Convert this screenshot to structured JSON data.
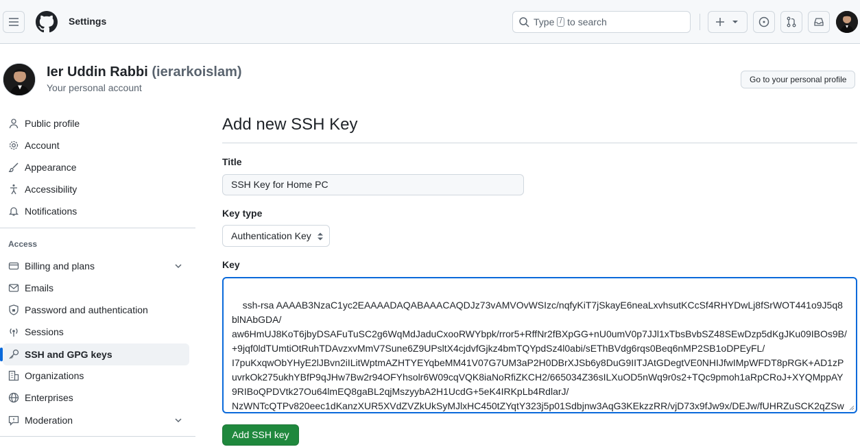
{
  "header": {
    "context_title": "Settings",
    "search_prefix": "Type",
    "search_kbd": "/",
    "search_suffix": "to search"
  },
  "profile": {
    "name": "Ier Uddin Rabbi",
    "login": "(ierarkoislam)",
    "subtitle": "Your personal account",
    "go_to_profile": "Go to your personal profile"
  },
  "sidebar": {
    "items": [
      {
        "label": "Public profile",
        "icon": "person-icon"
      },
      {
        "label": "Account",
        "icon": "gear-icon"
      },
      {
        "label": "Appearance",
        "icon": "paintbrush-icon"
      },
      {
        "label": "Accessibility",
        "icon": "accessibility-icon"
      },
      {
        "label": "Notifications",
        "icon": "bell-icon"
      }
    ],
    "access_heading": "Access",
    "access_items": [
      {
        "label": "Billing and plans",
        "icon": "credit-card-icon",
        "expandable": true
      },
      {
        "label": "Emails",
        "icon": "mail-icon"
      },
      {
        "label": "Password and authentication",
        "icon": "shield-lock-icon"
      },
      {
        "label": "Sessions",
        "icon": "broadcast-icon"
      },
      {
        "label": "SSH and GPG keys",
        "icon": "key-icon",
        "active": true
      },
      {
        "label": "Organizations",
        "icon": "organization-icon"
      },
      {
        "label": "Enterprises",
        "icon": "globe-icon"
      },
      {
        "label": "Moderation",
        "icon": "report-icon",
        "expandable": true
      }
    ]
  },
  "form": {
    "heading": "Add new SSH Key",
    "title_label": "Title",
    "title_value": "SSH Key for Home PC",
    "key_type_label": "Key type",
    "key_type_value": "Authentication Key",
    "key_label": "Key",
    "key_value": "ssh-rsa AAAAB3NzaC1yc2EAAAADAQABAAACAQDJz73vAMVOvWSIzc/nqfyKiT7jSkayE6neaLxvhsutKCcSf4RHYDwLj8fSrWOT441o9J5q8blNAbGDA/\naw6HmUJ8KoT6jbyDSAFuTuSC2g6WqMdJaduCxooRWYbpk/rror5+RffNr2fBXpGG+nU0umV0p7JJl1xTbsBvbSZ48SEwDzp5dKgJKu09IBOs9B/\n+9jqf0ldTUmtiOtRuhTDAvzxvMmV7Sune6Z9UPsltX4cjdvfGjkz4bmTQYpdSz4l0abi/sEThBVdg6rqs0Beq6nMP2SB1oDPEyFL/\nI7puKxqwObYHyE2lJBvn2iILitWptmAZHTYEYqbeMM41V07G7UM3aP2H0DBrXJSb6y8DuG9IITJAtGDegtVE0NHIJfwIMpWFDT8pRGK+AD1zPuvrkOk275ukhYBfP9qJHw7Bw2r94OFYhsolr6W09cqVQK8iaNoRfiZKCH2/665034Z36sILXuOD5nWq9r0s2+TQc9pmoh1aRpCRoJ+XYQMppAY9RIBoQPDVtk27Ou64lmEQ8gaBL2qjMszyybA2H1UcdG+5eK4IRKpLb4RdlarJ/\nNzWNTcQTPv820eec1dKanzXUR5XVdZVZkUkSyMJlxHC450tZYqtY323j5p01Sdbjnw3AqG3KEkzzRR/vjD73x9fJw9x/DEJw/fUHRZuSCK2qZSw==\nierarkoislam@gmail.com\n",
    "submit_label": "Add SSH key"
  }
}
